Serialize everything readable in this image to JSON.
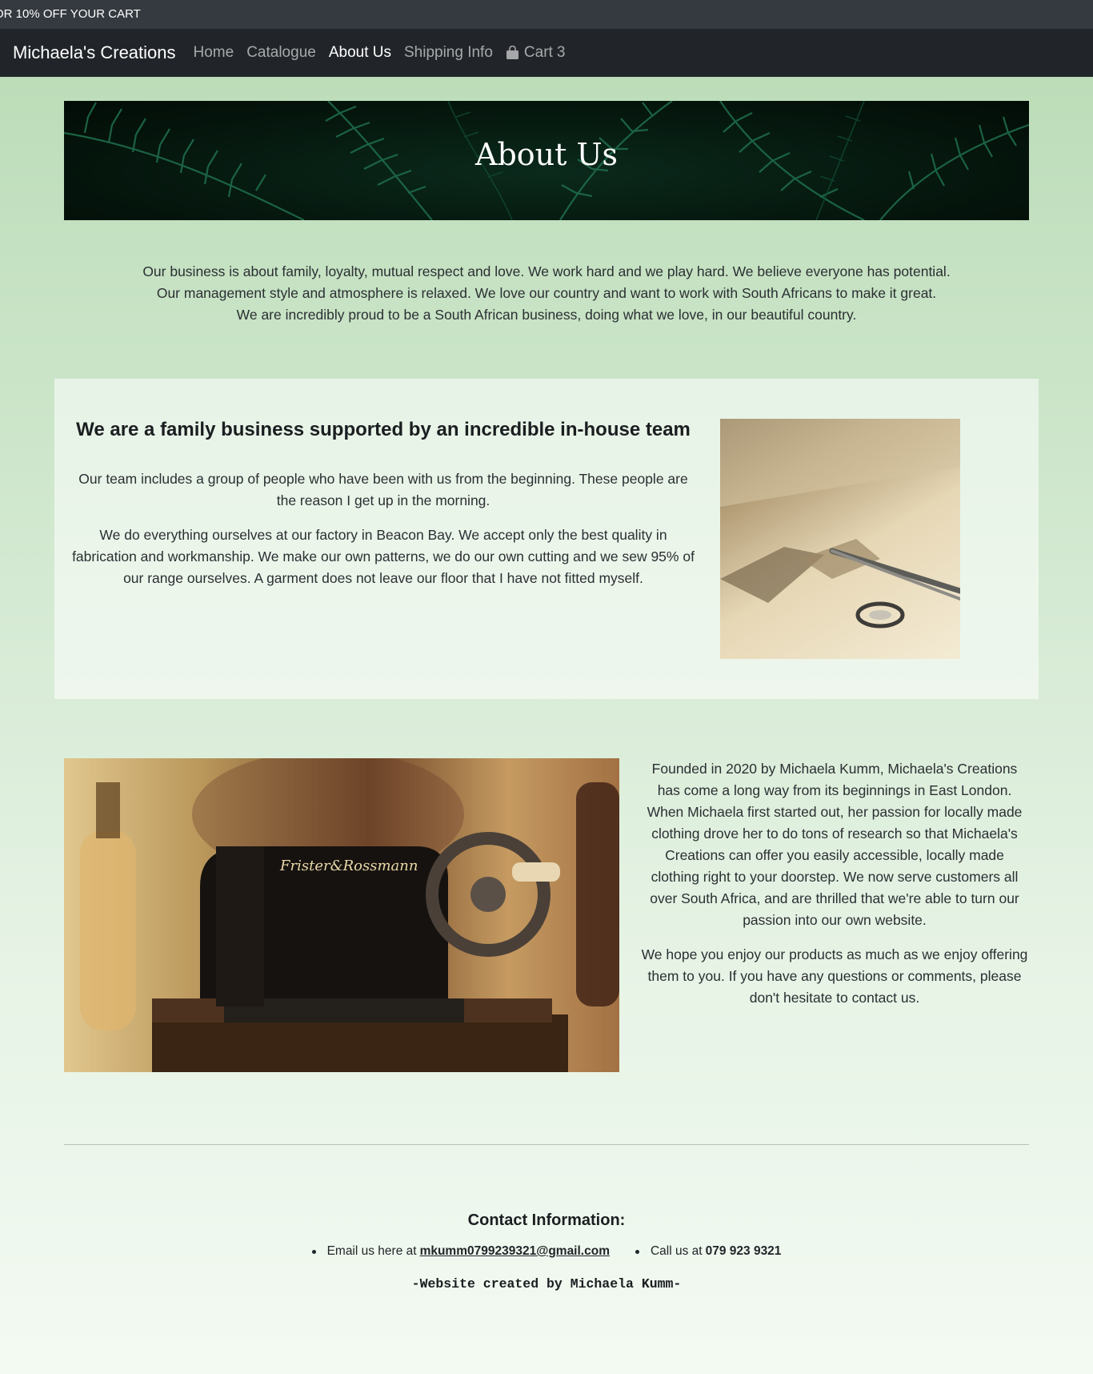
{
  "promo": {
    "text": "OR 10% OFF YOUR CART"
  },
  "nav": {
    "brand": "Michaela's Creations",
    "items": [
      {
        "label": "Home"
      },
      {
        "label": "Catalogue"
      },
      {
        "label": "About Us"
      },
      {
        "label": "Shipping Info"
      }
    ],
    "cart_label": "Cart",
    "cart_count": "3",
    "cart_icon": "shopping-bag-icon"
  },
  "hero": {
    "title": "About Us"
  },
  "intro": {
    "lines": [
      "Our business is about family, loyalty, mutual respect and love. We work hard and we play hard. We believe everyone has potential.",
      "Our management style and atmosphere is relaxed. We love our country and want to work with South Africans to make it great.",
      "We are incredibly proud to be a South African business, doing what we love, in our beautiful country."
    ]
  },
  "team": {
    "heading": "We are a family business supported by an incredible in-house team",
    "p1": "Our team includes a group of people who have been with us from the beginning. These people are the reason I get up in the morning.",
    "p2": "We do everything ourselves at our factory in Beacon Bay. We accept only the best quality in fabrication and workmanship. We make our own patterns, we do our own cutting and we sew 95% of our range ourselves. A garment does not leave our floor that I have not fitted myself."
  },
  "story": {
    "p1": "Founded in 2020 by Michaela Kumm, Michaela's Creations has come a long way from its beginnings in East London. When Michaela first started out, her passion for locally made clothing drove her to do tons of research so that Michaela's Creations can offer you easily accessible, locally made clothing right to your doorstep. We now serve customers all over South Africa, and are thrilled that we're able to turn our passion into our own website.",
    "p2": "We hope you enjoy our products as much as we enjoy offering them to you. If you have any questions or comments, please don't hesitate to contact us.",
    "image_label": "Frister&Rossmann"
  },
  "contact": {
    "title": "Contact Information:",
    "email_prefix": "Email us here at",
    "email": "mkumm0799239321@gmail.com",
    "phone_prefix": "Call us at",
    "phone": "079 923 9321"
  },
  "footer": {
    "credit": "-Website created by Michaela Kumm-"
  }
}
